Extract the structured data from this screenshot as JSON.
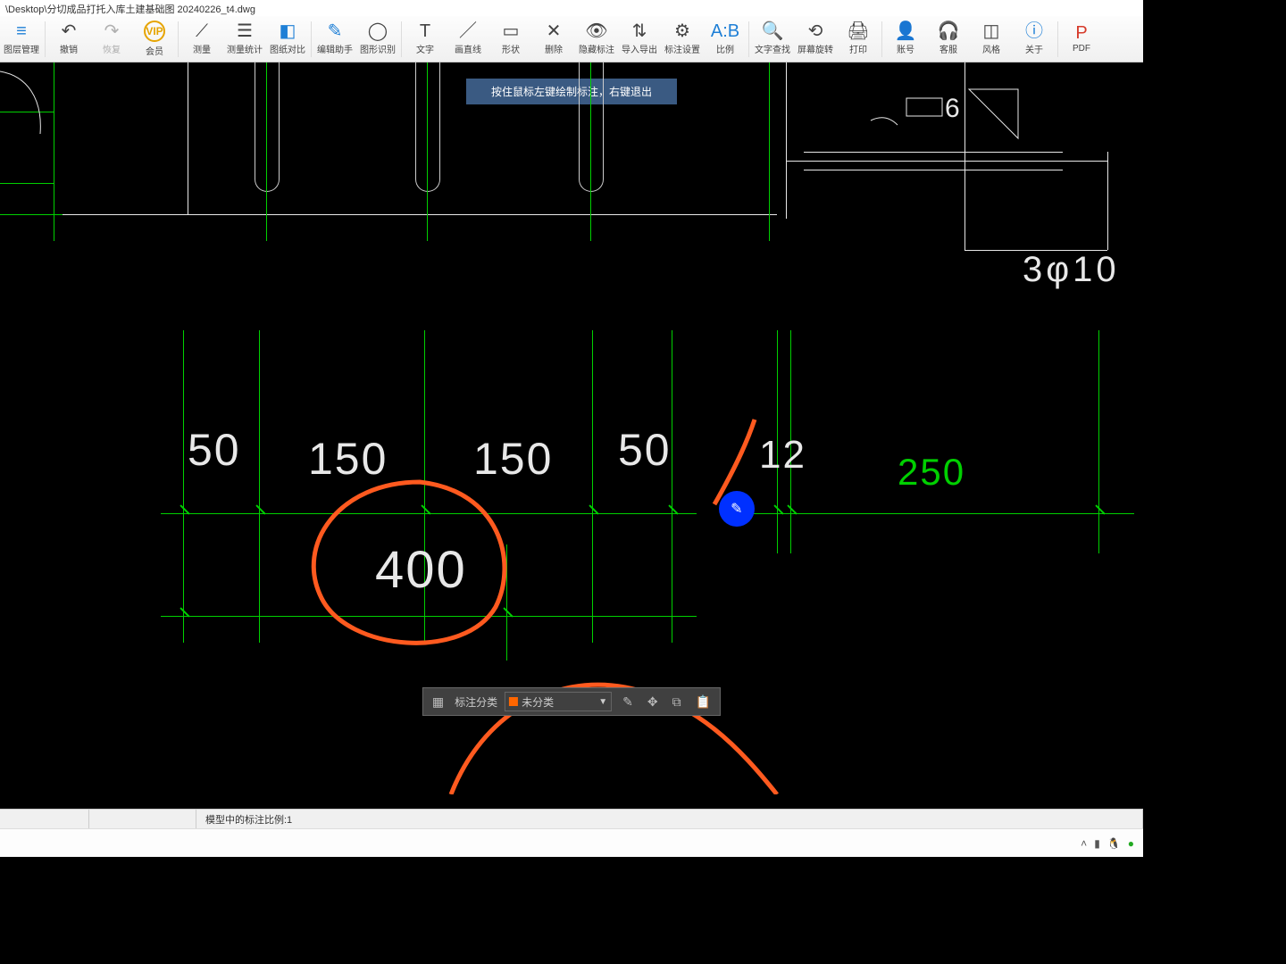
{
  "title_path": "\\Desktop\\分切成品打托入库土建基础图 20240226_t4.dwg",
  "toolbar": [
    {
      "label": "图层管理",
      "icon": "≡",
      "cls": "ico-blue"
    },
    {
      "label": "撤销",
      "icon": "↶",
      "cls": ""
    },
    {
      "label": "恢复",
      "icon": "↷",
      "cls": "",
      "muted": true
    },
    {
      "label": "会员",
      "icon": "VIP",
      "cls": "vip"
    },
    {
      "label": "测量",
      "icon": "⟋",
      "cls": ""
    },
    {
      "label": "测量统计",
      "icon": "☰",
      "cls": ""
    },
    {
      "label": "图纸对比",
      "icon": "◧",
      "cls": "ico-blue"
    },
    {
      "label": "编辑助手",
      "icon": "✎",
      "cls": "ico-blue"
    },
    {
      "label": "图形识别",
      "icon": "◯",
      "cls": ""
    },
    {
      "label": "文字",
      "icon": "T",
      "cls": ""
    },
    {
      "label": "画直线",
      "icon": "／",
      "cls": ""
    },
    {
      "label": "形状",
      "icon": "▭",
      "cls": ""
    },
    {
      "label": "删除",
      "icon": "✕",
      "cls": ""
    },
    {
      "label": "隐藏标注",
      "icon": "👁",
      "cls": ""
    },
    {
      "label": "导入导出",
      "icon": "⇅",
      "cls": ""
    },
    {
      "label": "标注设置",
      "icon": "⚙",
      "cls": ""
    },
    {
      "label": "比例",
      "icon": "A:B",
      "cls": "ico-blue"
    },
    {
      "label": "文字查找",
      "icon": "🔍",
      "cls": ""
    },
    {
      "label": "屏幕旋转",
      "icon": "⟲",
      "cls": ""
    },
    {
      "label": "打印",
      "icon": "🖨",
      "cls": ""
    },
    {
      "label": "账号",
      "icon": "👤",
      "cls": "ico-blue"
    },
    {
      "label": "客服",
      "icon": "🎧",
      "cls": "ico-blue"
    },
    {
      "label": "风格",
      "icon": "◫",
      "cls": ""
    },
    {
      "label": "关于",
      "icon": "ⓘ",
      "cls": "ico-blue"
    },
    {
      "label": "PDF",
      "icon": "P",
      "cls": "ico-red"
    }
  ],
  "hint": "按住鼠标左键绘制标注，右键退出",
  "dims": {
    "d50a": "50",
    "d150a": "150",
    "d150b": "150",
    "d50b": "50",
    "d12": "12",
    "d250": "250",
    "d400": "400",
    "d6": "6",
    "d3phi10": "3φ10"
  },
  "bottom": {
    "label": "标注分类",
    "option": "未分类"
  },
  "status_text": "模型中的标注比例:1"
}
